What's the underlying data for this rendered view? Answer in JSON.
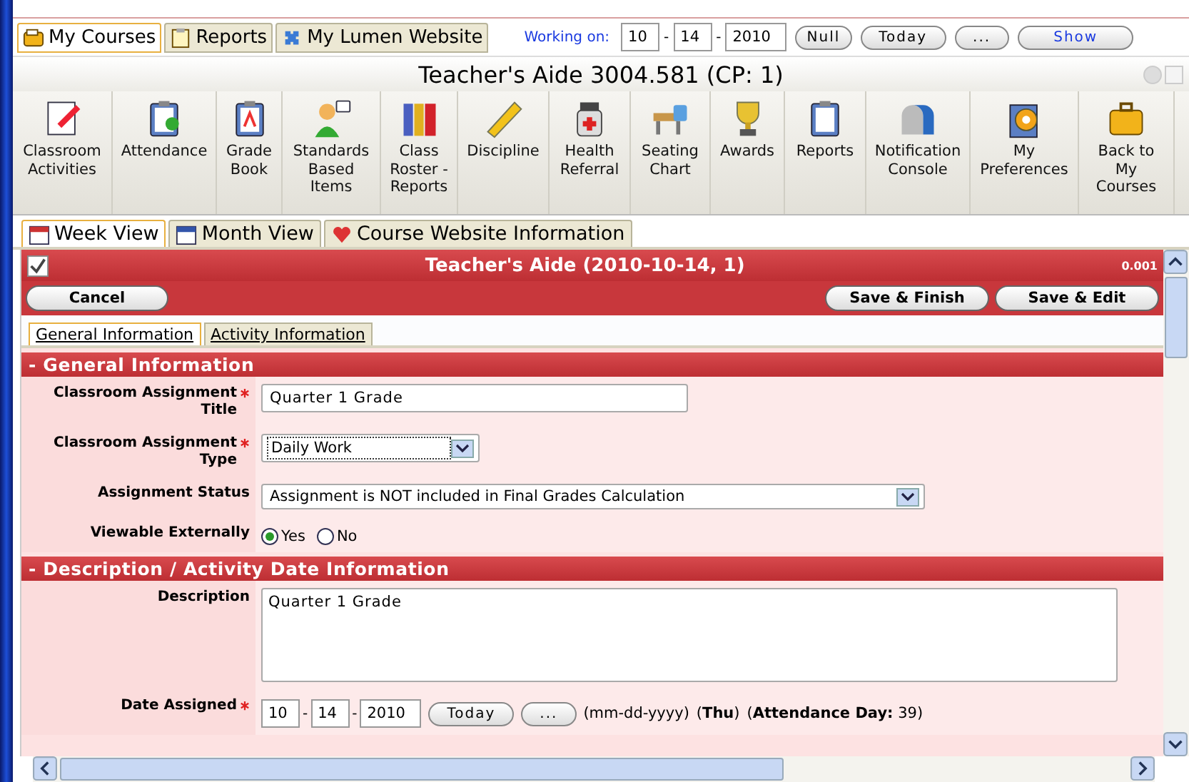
{
  "top_tabs": [
    {
      "label": "My Courses",
      "selected": true
    },
    {
      "label": "Reports",
      "selected": false
    },
    {
      "label": "My Lumen Website",
      "selected": false
    }
  ],
  "working_on": {
    "label": "Working on:",
    "date": [
      "10",
      "14",
      "2010"
    ],
    "separators": [
      "-",
      "-"
    ],
    "buttons": [
      "Null",
      "Today",
      "...",
      "Show"
    ]
  },
  "title": "Teacher's Aide 3004.581 (CP: 1)",
  "toolbar": [
    "Classroom\nActivities",
    "Attendance",
    "Grade\nBook",
    "Standards\nBased\nItems",
    "Class\nRoster -\nReports",
    "Discipline",
    "Health\nReferral",
    "Seating\nChart",
    "Awards",
    "Reports",
    "Notification\nConsole",
    "My\nPreferences",
    "Back to\nMy\nCourses"
  ],
  "view_tabs": [
    {
      "label": "Week View",
      "selected": true
    },
    {
      "label": "Month View",
      "selected": false
    },
    {
      "label": "Course Website Information",
      "selected": false
    }
  ],
  "panel": {
    "title": "Teacher's Aide (2010-10-14, 1)",
    "version": "0.001",
    "left_buttons": [
      "Cancel"
    ],
    "right_buttons": [
      "Save & Finish",
      "Save & Edit"
    ],
    "form_tabs": [
      {
        "label": "General Information",
        "selected": true
      },
      {
        "label": "Activity Information",
        "selected": false
      }
    ],
    "sections": [
      {
        "title": "- General Information",
        "fields": [
          {
            "kind": "text",
            "label": "Classroom Assignment Title",
            "required": true,
            "value": "Quarter 1 Grade"
          },
          {
            "kind": "select",
            "label": "Classroom Assignment Type",
            "required": true,
            "value": "Daily Work",
            "wide": false
          },
          {
            "kind": "select",
            "label": "Assignment Status",
            "required": false,
            "value": "Assignment is NOT included in Final Grades Calculation",
            "wide": true
          },
          {
            "kind": "radio",
            "label": "Viewable Externally",
            "required": false,
            "options": [
              {
                "label": "Yes",
                "selected": true
              },
              {
                "label": "No",
                "selected": false
              }
            ]
          }
        ]
      },
      {
        "title": "- Description / Activity Date Information",
        "fields": [
          {
            "kind": "textarea",
            "label": "Description",
            "required": false,
            "value": "Quarter 1 Grade"
          },
          {
            "kind": "date",
            "label": "Date Assigned",
            "required": true,
            "date": [
              "10",
              "14",
              "2010"
            ],
            "separators": [
              "-",
              "-"
            ],
            "buttons": [
              "Today",
              "..."
            ],
            "notes": [
              "(mm-dd-yyyy)",
              "(**Thu**)",
              "(**Attendance Day:** 39)"
            ]
          }
        ]
      }
    ]
  }
}
